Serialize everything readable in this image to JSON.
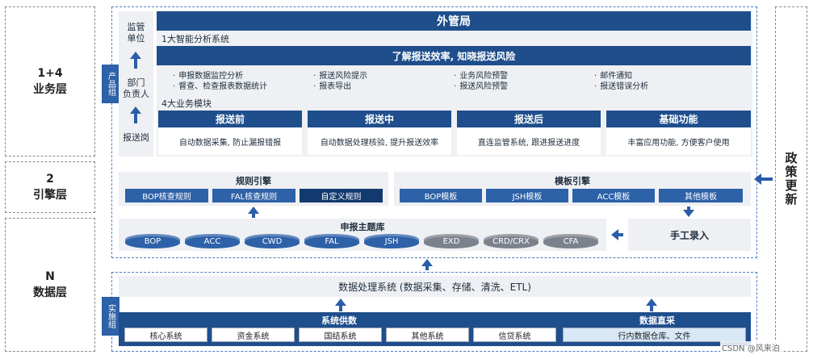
{
  "layers": {
    "business": "1+4\n业务层",
    "engine": "2\n引擎层",
    "data": "N\n数据层"
  },
  "side_labels": {
    "product_group": "产品组",
    "impl_group": "实施组",
    "policy": "政策更新"
  },
  "roles": {
    "supervisor": "监管\n单位",
    "manager": "部门\n负责人",
    "reporter": "报送岗"
  },
  "header": {
    "bureau": "外管局",
    "analysis_system": "1大智能分析系统",
    "slogan": "了解报送效率, 知晓报送风险"
  },
  "analysis_features": [
    [
      "申报数据监控分析",
      "督查、检查报表数据统计"
    ],
    [
      "报送风险提示",
      "报表导出"
    ],
    [
      "业务风险预警",
      "报送风险预警"
    ],
    [
      "邮件通知",
      "报送错误分析"
    ]
  ],
  "modules": {
    "title": "4大业务模块",
    "items": [
      {
        "name": "报送前",
        "desc": "自动数据采集, 防止漏报错报"
      },
      {
        "name": "报送中",
        "desc": "自动数据处理核验, 提升报送效率"
      },
      {
        "name": "报送后",
        "desc": "直连监管系统, 跟进报送进度"
      },
      {
        "name": "基础功能",
        "desc": "丰富应用功能, 方便客户使用"
      }
    ]
  },
  "rule_engine": {
    "title": "规则引擎",
    "items": [
      "BOP核查规则",
      "FAL核查规则",
      "自定义规则"
    ]
  },
  "template_engine": {
    "title": "模板引擎",
    "items": [
      "BOP模板",
      "JSH模板",
      "ACC模板",
      "其他模板"
    ]
  },
  "subject_db": {
    "title": "申报主题库",
    "blue": [
      "BOP",
      "ACC",
      "CWD",
      "FAL",
      "JSH"
    ],
    "grey": [
      "EXD",
      "CRD/CRX",
      "CFA"
    ]
  },
  "manual_entry": "手工录入",
  "data_processing": "数据处理系统 (数据采集、存储、清洗、ETL)",
  "system_supply": {
    "title": "系统供数",
    "items": [
      "核心系统",
      "资金系统",
      "国结系统",
      "其他系统",
      "信贷系统"
    ]
  },
  "direct_collect": {
    "title": "数据直采",
    "item": "行内数据仓库、文件"
  },
  "watermark": "CSDN @风来泊",
  "colors": {
    "navy": "#1f4e8c",
    "dark_navy": "#123a6e",
    "arrow": "#2a5ca8",
    "grey_db": "#7b828d"
  }
}
